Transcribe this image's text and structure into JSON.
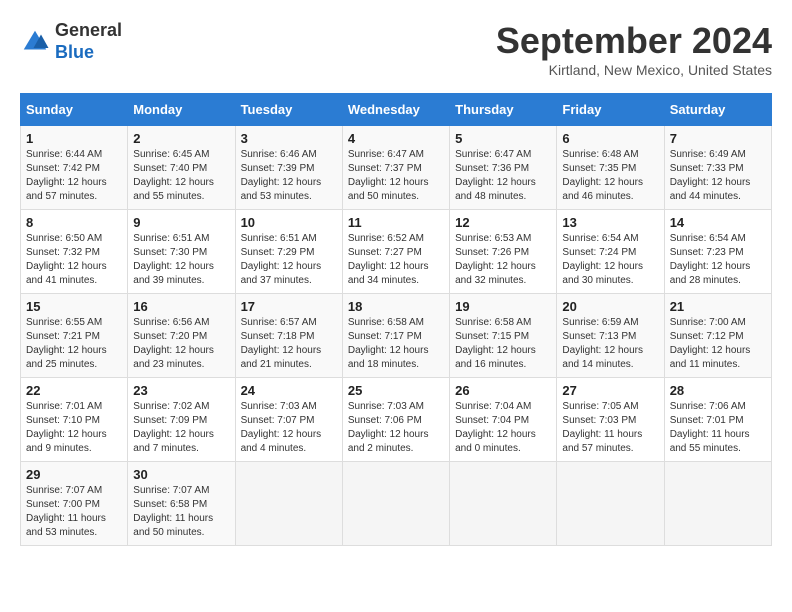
{
  "logo": {
    "line1": "General",
    "line2": "Blue"
  },
  "title": "September 2024",
  "location": "Kirtland, New Mexico, United States",
  "days_of_week": [
    "Sunday",
    "Monday",
    "Tuesday",
    "Wednesday",
    "Thursday",
    "Friday",
    "Saturday"
  ],
  "weeks": [
    [
      {
        "day": "1",
        "sunrise": "6:44 AM",
        "sunset": "7:42 PM",
        "daylight": "12 hours and 57 minutes."
      },
      {
        "day": "2",
        "sunrise": "6:45 AM",
        "sunset": "7:40 PM",
        "daylight": "12 hours and 55 minutes."
      },
      {
        "day": "3",
        "sunrise": "6:46 AM",
        "sunset": "7:39 PM",
        "daylight": "12 hours and 53 minutes."
      },
      {
        "day": "4",
        "sunrise": "6:47 AM",
        "sunset": "7:37 PM",
        "daylight": "12 hours and 50 minutes."
      },
      {
        "day": "5",
        "sunrise": "6:47 AM",
        "sunset": "7:36 PM",
        "daylight": "12 hours and 48 minutes."
      },
      {
        "day": "6",
        "sunrise": "6:48 AM",
        "sunset": "7:35 PM",
        "daylight": "12 hours and 46 minutes."
      },
      {
        "day": "7",
        "sunrise": "6:49 AM",
        "sunset": "7:33 PM",
        "daylight": "12 hours and 44 minutes."
      }
    ],
    [
      {
        "day": "8",
        "sunrise": "6:50 AM",
        "sunset": "7:32 PM",
        "daylight": "12 hours and 41 minutes."
      },
      {
        "day": "9",
        "sunrise": "6:51 AM",
        "sunset": "7:30 PM",
        "daylight": "12 hours and 39 minutes."
      },
      {
        "day": "10",
        "sunrise": "6:51 AM",
        "sunset": "7:29 PM",
        "daylight": "12 hours and 37 minutes."
      },
      {
        "day": "11",
        "sunrise": "6:52 AM",
        "sunset": "7:27 PM",
        "daylight": "12 hours and 34 minutes."
      },
      {
        "day": "12",
        "sunrise": "6:53 AM",
        "sunset": "7:26 PM",
        "daylight": "12 hours and 32 minutes."
      },
      {
        "day": "13",
        "sunrise": "6:54 AM",
        "sunset": "7:24 PM",
        "daylight": "12 hours and 30 minutes."
      },
      {
        "day": "14",
        "sunrise": "6:54 AM",
        "sunset": "7:23 PM",
        "daylight": "12 hours and 28 minutes."
      }
    ],
    [
      {
        "day": "15",
        "sunrise": "6:55 AM",
        "sunset": "7:21 PM",
        "daylight": "12 hours and 25 minutes."
      },
      {
        "day": "16",
        "sunrise": "6:56 AM",
        "sunset": "7:20 PM",
        "daylight": "12 hours and 23 minutes."
      },
      {
        "day": "17",
        "sunrise": "6:57 AM",
        "sunset": "7:18 PM",
        "daylight": "12 hours and 21 minutes."
      },
      {
        "day": "18",
        "sunrise": "6:58 AM",
        "sunset": "7:17 PM",
        "daylight": "12 hours and 18 minutes."
      },
      {
        "day": "19",
        "sunrise": "6:58 AM",
        "sunset": "7:15 PM",
        "daylight": "12 hours and 16 minutes."
      },
      {
        "day": "20",
        "sunrise": "6:59 AM",
        "sunset": "7:13 PM",
        "daylight": "12 hours and 14 minutes."
      },
      {
        "day": "21",
        "sunrise": "7:00 AM",
        "sunset": "7:12 PM",
        "daylight": "12 hours and 11 minutes."
      }
    ],
    [
      {
        "day": "22",
        "sunrise": "7:01 AM",
        "sunset": "7:10 PM",
        "daylight": "12 hours and 9 minutes."
      },
      {
        "day": "23",
        "sunrise": "7:02 AM",
        "sunset": "7:09 PM",
        "daylight": "12 hours and 7 minutes."
      },
      {
        "day": "24",
        "sunrise": "7:03 AM",
        "sunset": "7:07 PM",
        "daylight": "12 hours and 4 minutes."
      },
      {
        "day": "25",
        "sunrise": "7:03 AM",
        "sunset": "7:06 PM",
        "daylight": "12 hours and 2 minutes."
      },
      {
        "day": "26",
        "sunrise": "7:04 AM",
        "sunset": "7:04 PM",
        "daylight": "12 hours and 0 minutes."
      },
      {
        "day": "27",
        "sunrise": "7:05 AM",
        "sunset": "7:03 PM",
        "daylight": "11 hours and 57 minutes."
      },
      {
        "day": "28",
        "sunrise": "7:06 AM",
        "sunset": "7:01 PM",
        "daylight": "11 hours and 55 minutes."
      }
    ],
    [
      {
        "day": "29",
        "sunrise": "7:07 AM",
        "sunset": "7:00 PM",
        "daylight": "11 hours and 53 minutes."
      },
      {
        "day": "30",
        "sunrise": "7:07 AM",
        "sunset": "6:58 PM",
        "daylight": "11 hours and 50 minutes."
      },
      null,
      null,
      null,
      null,
      null
    ]
  ]
}
